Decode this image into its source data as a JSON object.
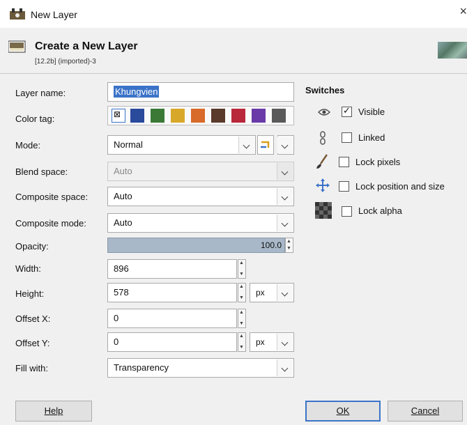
{
  "window": {
    "title": "New Layer",
    "close_glyph": "×"
  },
  "header": {
    "title": "Create a New Layer",
    "subtitle": "[12.2b] (imported)-3"
  },
  "labels": {
    "layer_name": "Layer name:",
    "color_tag": "Color tag:",
    "mode": "Mode:",
    "blend_space": "Blend space:",
    "composite_space": "Composite space:",
    "composite_mode": "Composite mode:",
    "opacity": "Opacity:",
    "width": "Width:",
    "height": "Height:",
    "offset_x": "Offset X:",
    "offset_y": "Offset Y:",
    "fill_with": "Fill with:"
  },
  "fields": {
    "layer_name": "Khungvien",
    "mode": "Normal",
    "blend_space": "Auto",
    "composite_space": "Auto",
    "composite_mode": "Auto",
    "opacity": "100.0",
    "opacity_fraction": 1.0,
    "width": "896",
    "height": "578",
    "size_unit": "px",
    "offset_x": "0",
    "offset_y": "0",
    "offset_unit": "px",
    "fill_with": "Transparency"
  },
  "color_tags": [
    {
      "name": "none",
      "color": "#ffffff"
    },
    {
      "name": "blue",
      "color": "#2a4a9c"
    },
    {
      "name": "green",
      "color": "#3a7a36"
    },
    {
      "name": "yellow",
      "color": "#d8a82a"
    },
    {
      "name": "orange",
      "color": "#d86a2a"
    },
    {
      "name": "brown",
      "color": "#5a3a2a"
    },
    {
      "name": "red",
      "color": "#b8283a"
    },
    {
      "name": "violet",
      "color": "#6a3aa8"
    },
    {
      "name": "gray",
      "color": "#5a5a5a"
    }
  ],
  "switches": {
    "title": "Switches",
    "items": [
      {
        "label": "Visible",
        "checked": true,
        "icon": "eye-icon"
      },
      {
        "label": "Linked",
        "checked": false,
        "icon": "chain-icon"
      },
      {
        "label": "Lock pixels",
        "checked": false,
        "icon": "brush-icon"
      },
      {
        "label": "Lock position and size",
        "checked": false,
        "icon": "move-icon"
      },
      {
        "label": "Lock alpha",
        "checked": false,
        "icon": "checker-icon"
      }
    ]
  },
  "buttons": {
    "help": "Help",
    "ok": "OK",
    "cancel": "Cancel"
  },
  "colors": {
    "selection": "#3b73c8",
    "opacity_fill": "#a8b8c8",
    "ok_border": "#3b73c8"
  }
}
